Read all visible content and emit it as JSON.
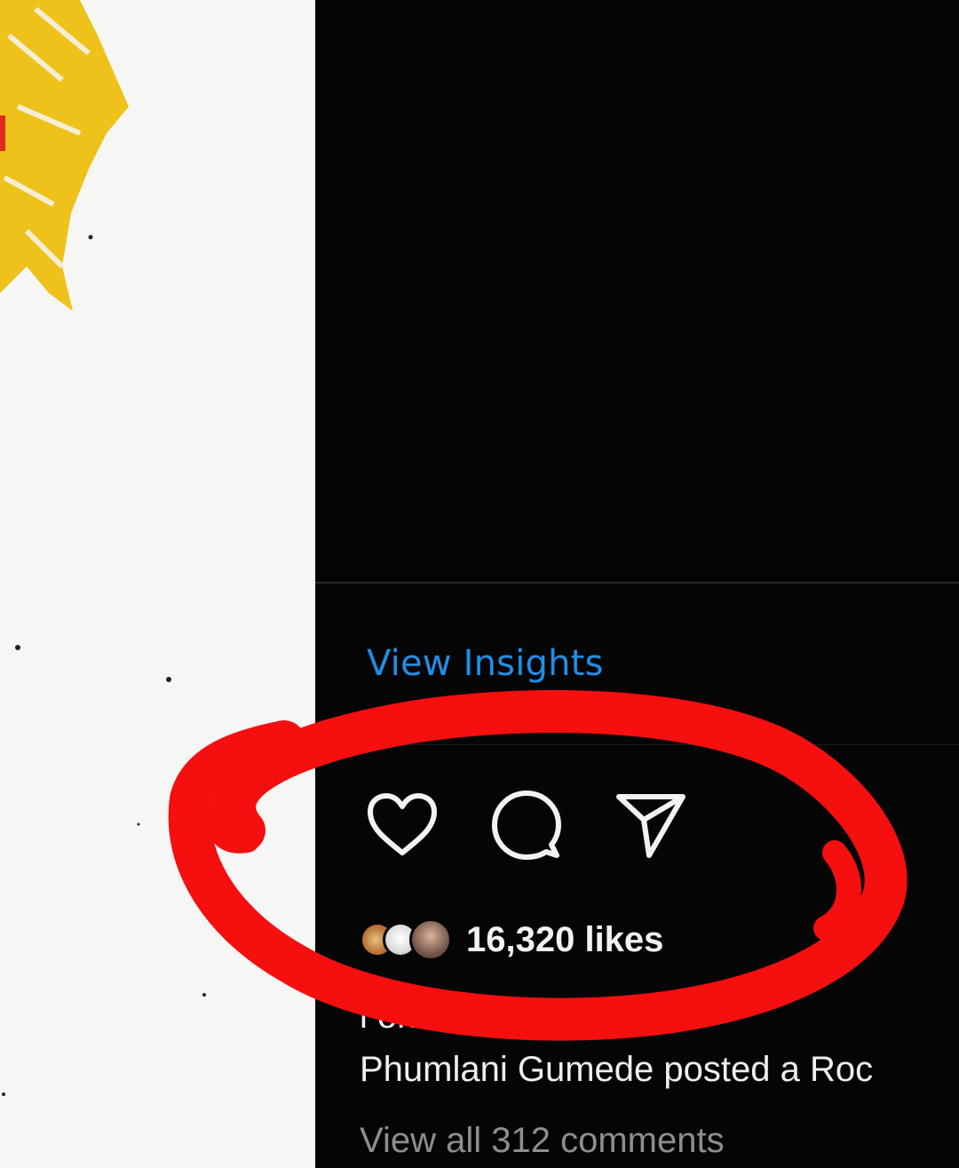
{
  "post": {
    "insights_label": "View Insights",
    "likes_label": "16,320 likes",
    "caption_line_1": "i                                okers creat",
    "caption_line_2": "Phumlani Gumede posted a Roc",
    "comments_label": "View all 312 comments"
  },
  "actions": [
    {
      "icon": "heart-icon"
    },
    {
      "icon": "comment-icon"
    },
    {
      "icon": "share-icon"
    }
  ],
  "colors": {
    "panel": "#050505",
    "link": "#1f8fe6",
    "annotation": "#f50f0f",
    "art_yellow": "#eec21a"
  }
}
